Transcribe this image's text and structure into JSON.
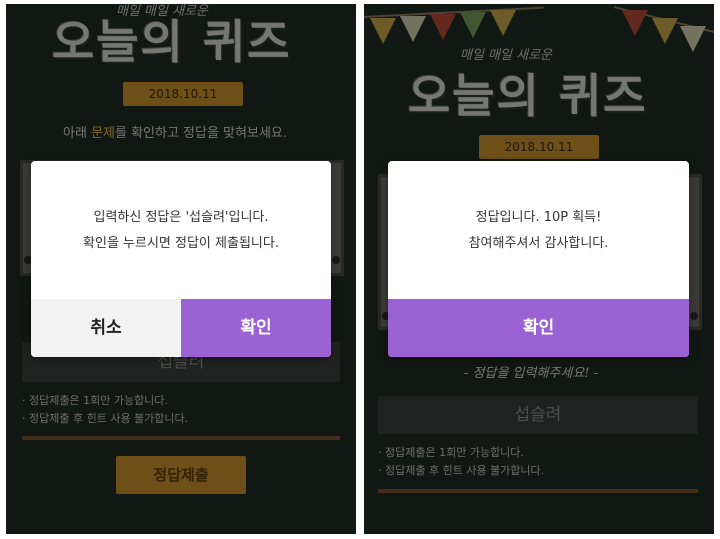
{
  "left_screen": {
    "header_script": "매일 매일 새로운",
    "title": "오늘의 퀴즈",
    "date": "2018.10.11",
    "instruction_pre": "아래 ",
    "instruction_hl": "문제",
    "instruction_post": "를 확인하고 정답을 맞혀보세요.",
    "answer_value": "섭슬려",
    "notes": [
      "· 정답제출은 1회만 가능합니다.",
      "· 정답제출 후 힌트 사용 불가합니다."
    ],
    "submit_label": "정답제출",
    "dialog": {
      "line1": "입력하신 정답은 '섭슬려'입니다.",
      "line2": "확인을 누르시면 정답이 제출됩니다.",
      "cancel_label": "취소",
      "ok_label": "확인"
    }
  },
  "right_screen": {
    "header_script": "매일 매일 새로운",
    "title": "오늘의 퀴즈",
    "date": "2018.10.11",
    "hint_text": "- 정답을 입력해주세요! -",
    "answer_value": "섭슬려",
    "notes": [
      "· 정답제출은 1회만 가능합니다.",
      "· 정답제출 후 힌트 사용 불가합니다."
    ],
    "dialog": {
      "line1": "정답입니다. 10P 획득!",
      "line2": "참여해주셔서 감사합니다.",
      "ok_label": "확인"
    }
  },
  "colors": {
    "chalkboard": "#1f2a24",
    "accent_purple": "#9b62d4",
    "ribbon_gold": "#c8912a"
  }
}
